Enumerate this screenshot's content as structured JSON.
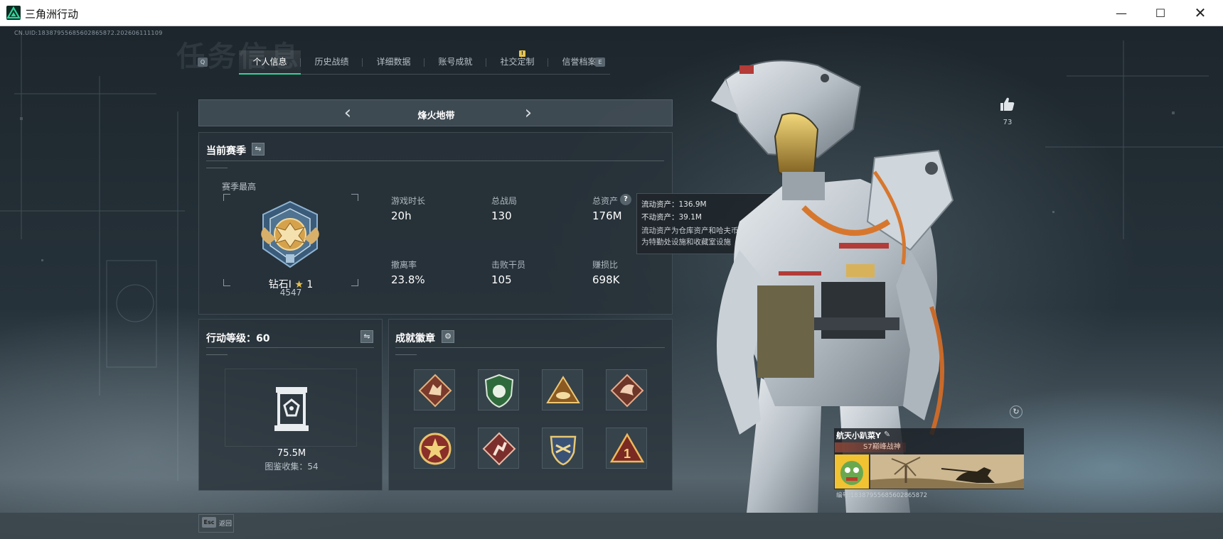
{
  "window": {
    "title": "三角洲行动",
    "minimize": "—",
    "maximize": "☐",
    "close": "✕"
  },
  "header": {
    "uid": "CN.UID:18387955685602865872.202606111109",
    "bg_title": "任务信息"
  },
  "tabs": {
    "prev_key": "Q",
    "next_key": "E",
    "items": [
      {
        "label": "个人信息",
        "active": true
      },
      {
        "label": "历史战绩",
        "active": false
      },
      {
        "label": "详细数据",
        "active": false
      },
      {
        "label": "账号成就",
        "active": false
      },
      {
        "label": "社交定制",
        "active": false
      },
      {
        "label": "信誉档案",
        "active": false
      }
    ],
    "alert": "!"
  },
  "mode": {
    "label": "烽火地带",
    "prev": "‹",
    "next": "›"
  },
  "season": {
    "title": "当前赛季",
    "swap_icon": "⇋",
    "best_label": "赛季最高",
    "rank_name": "钻石I",
    "rank_star": "★",
    "rank_stars": "1",
    "rank_score": "4547",
    "stats": [
      {
        "label": "游戏时长",
        "value": "20h"
      },
      {
        "label": "总战局",
        "value": "130"
      },
      {
        "label": "总资产",
        "value": "176M"
      },
      {
        "label": "撤离率",
        "value": "23.8%"
      },
      {
        "label": "击败干员",
        "value": "105"
      },
      {
        "label": "赚损比",
        "value": "698K"
      }
    ],
    "help": "?"
  },
  "tooltip": {
    "liquid": "流动资产：136.9M",
    "fixed": "不动资产：39.1M",
    "desc": "流动资产为仓库资产和哈夫币，不动资产为特勤处设施和收藏室设施"
  },
  "level": {
    "title": "行动等级：60",
    "swap_icon": "⇋",
    "value": "75.5M",
    "collect": "图鉴收集：54"
  },
  "badges": {
    "title": "成就徽章",
    "settings_icon": "⚙"
  },
  "character": {
    "likes": "73",
    "refresh_icon": "↻"
  },
  "player_card": {
    "name": "航天小趴菜Y",
    "edit_icon": "✎",
    "title": "S7巅峰战神",
    "uid": "编号:18387955685602865872"
  },
  "bottom": {
    "esc_key": "Esc",
    "esc_label": "返回"
  },
  "colors": {
    "accent": "#2fd59a",
    "star": "#e6c24d",
    "alert": "#e9c44b"
  }
}
